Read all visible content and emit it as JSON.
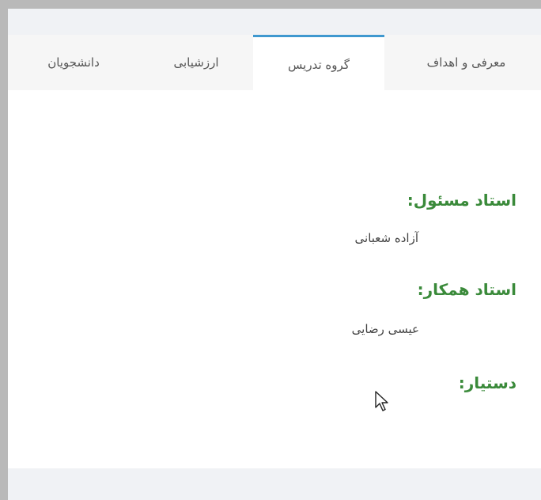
{
  "tabs": [
    {
      "label": "معرفی و اهداف",
      "active": false
    },
    {
      "label": "گروه تدریس",
      "active": true
    },
    {
      "label": "ارزشیابی",
      "active": false
    },
    {
      "label": "دانشجویان",
      "active": false
    }
  ],
  "content": {
    "responsible_label": "استاد مسئول:",
    "responsible_name": "آزاده شعبانی",
    "colleague_label": "استاد همکار:",
    "colleague_name": "عیسی رضایی",
    "assistant_label": "دستیار:"
  },
  "colors": {
    "accent": "#3f98cf",
    "label_green": "#3a8a3a"
  },
  "cursor_icon": "mouse-pointer-icon"
}
